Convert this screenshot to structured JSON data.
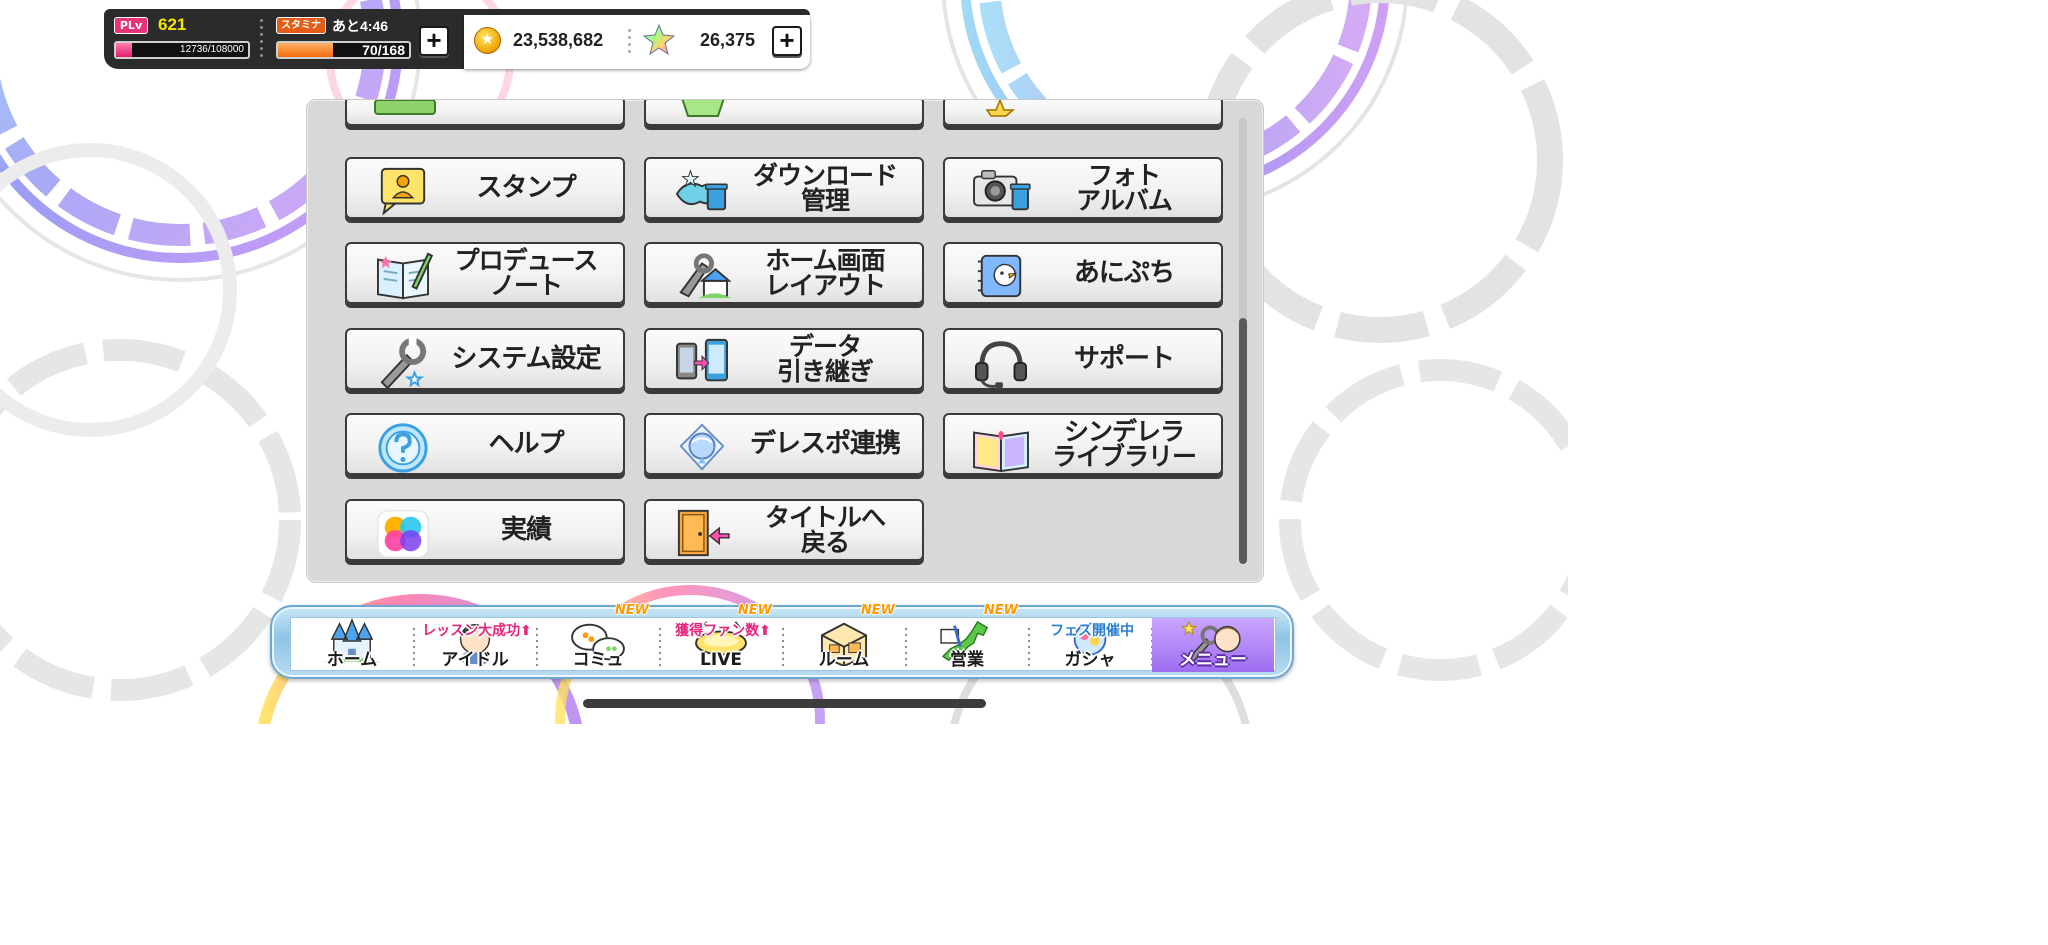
{
  "status": {
    "plv_badge": "PLv",
    "player_level": "621",
    "exp_text": "12736/108000",
    "exp_fraction": 0.118,
    "stamina_badge": "スタミナ",
    "stamina_timer": "あと4:46",
    "stamina_text": "70/168",
    "stamina_fraction": 0.417,
    "money": "23,538,682",
    "jewels": "26,375",
    "plus_symbol": "+"
  },
  "menu": {
    "items": [
      {
        "label": "スタンプ",
        "icon": "stamp-icon"
      },
      {
        "label": "ダウンロード\n管理",
        "icon": "download-manage-icon"
      },
      {
        "label": "フォト\nアルバム",
        "icon": "camera-album-icon"
      },
      {
        "label": "プロデュース\nノート",
        "icon": "notebook-icon"
      },
      {
        "label": "ホーム画面\nレイアウト",
        "icon": "home-layout-icon"
      },
      {
        "label": "あにぷち",
        "icon": "anipuchi-icon"
      },
      {
        "label": "システム設定",
        "icon": "wrench-icon"
      },
      {
        "label": "データ\n引き継ぎ",
        "icon": "data-transfer-icon"
      },
      {
        "label": "サポート",
        "icon": "headset-icon"
      },
      {
        "label": "ヘルプ",
        "icon": "help-icon"
      },
      {
        "label": "デレスポ連携",
        "icon": "deresupo-icon"
      },
      {
        "label": "シンデレラ\nライブラリー",
        "icon": "library-book-icon"
      },
      {
        "label": "実績",
        "icon": "achievements-icon"
      },
      {
        "label": "タイトルへ\n戻る",
        "icon": "exit-door-icon"
      }
    ]
  },
  "nav": {
    "new_badge": "NEW",
    "items": [
      {
        "label": "ホーム",
        "promo": "",
        "new": false,
        "icon": "castle-icon"
      },
      {
        "label": "アイドル",
        "promo": "レッスン大成功⬆",
        "new": false,
        "icon": "idol-icon"
      },
      {
        "label": "コミュ",
        "promo": "",
        "new": true,
        "icon": "chat-bubbles-icon"
      },
      {
        "label": "LIVE",
        "promo": "獲得ファン数⬆",
        "new": true,
        "icon": "live-icon"
      },
      {
        "label": "ルーム",
        "promo": "",
        "new": true,
        "icon": "room-icon"
      },
      {
        "label": "営業",
        "promo": "",
        "new": true,
        "icon": "japan-map-icon"
      },
      {
        "label": "ガシャ",
        "promo": "フェス開催中",
        "new": false,
        "icon": "gacha-icon"
      },
      {
        "label": "メニュー",
        "promo": "",
        "new": false,
        "icon": "menu-wrench-icon"
      }
    ]
  },
  "colors": {
    "plv_pink": "#e8327a",
    "stamina_orange": "#f26a0a",
    "level_yellow": "#f2e600",
    "new_orange": "#ff9a00",
    "promo_pink": "#e8247c",
    "promo_blue": "#2a7fd1",
    "menu_active_purple": "#9e6df0"
  }
}
